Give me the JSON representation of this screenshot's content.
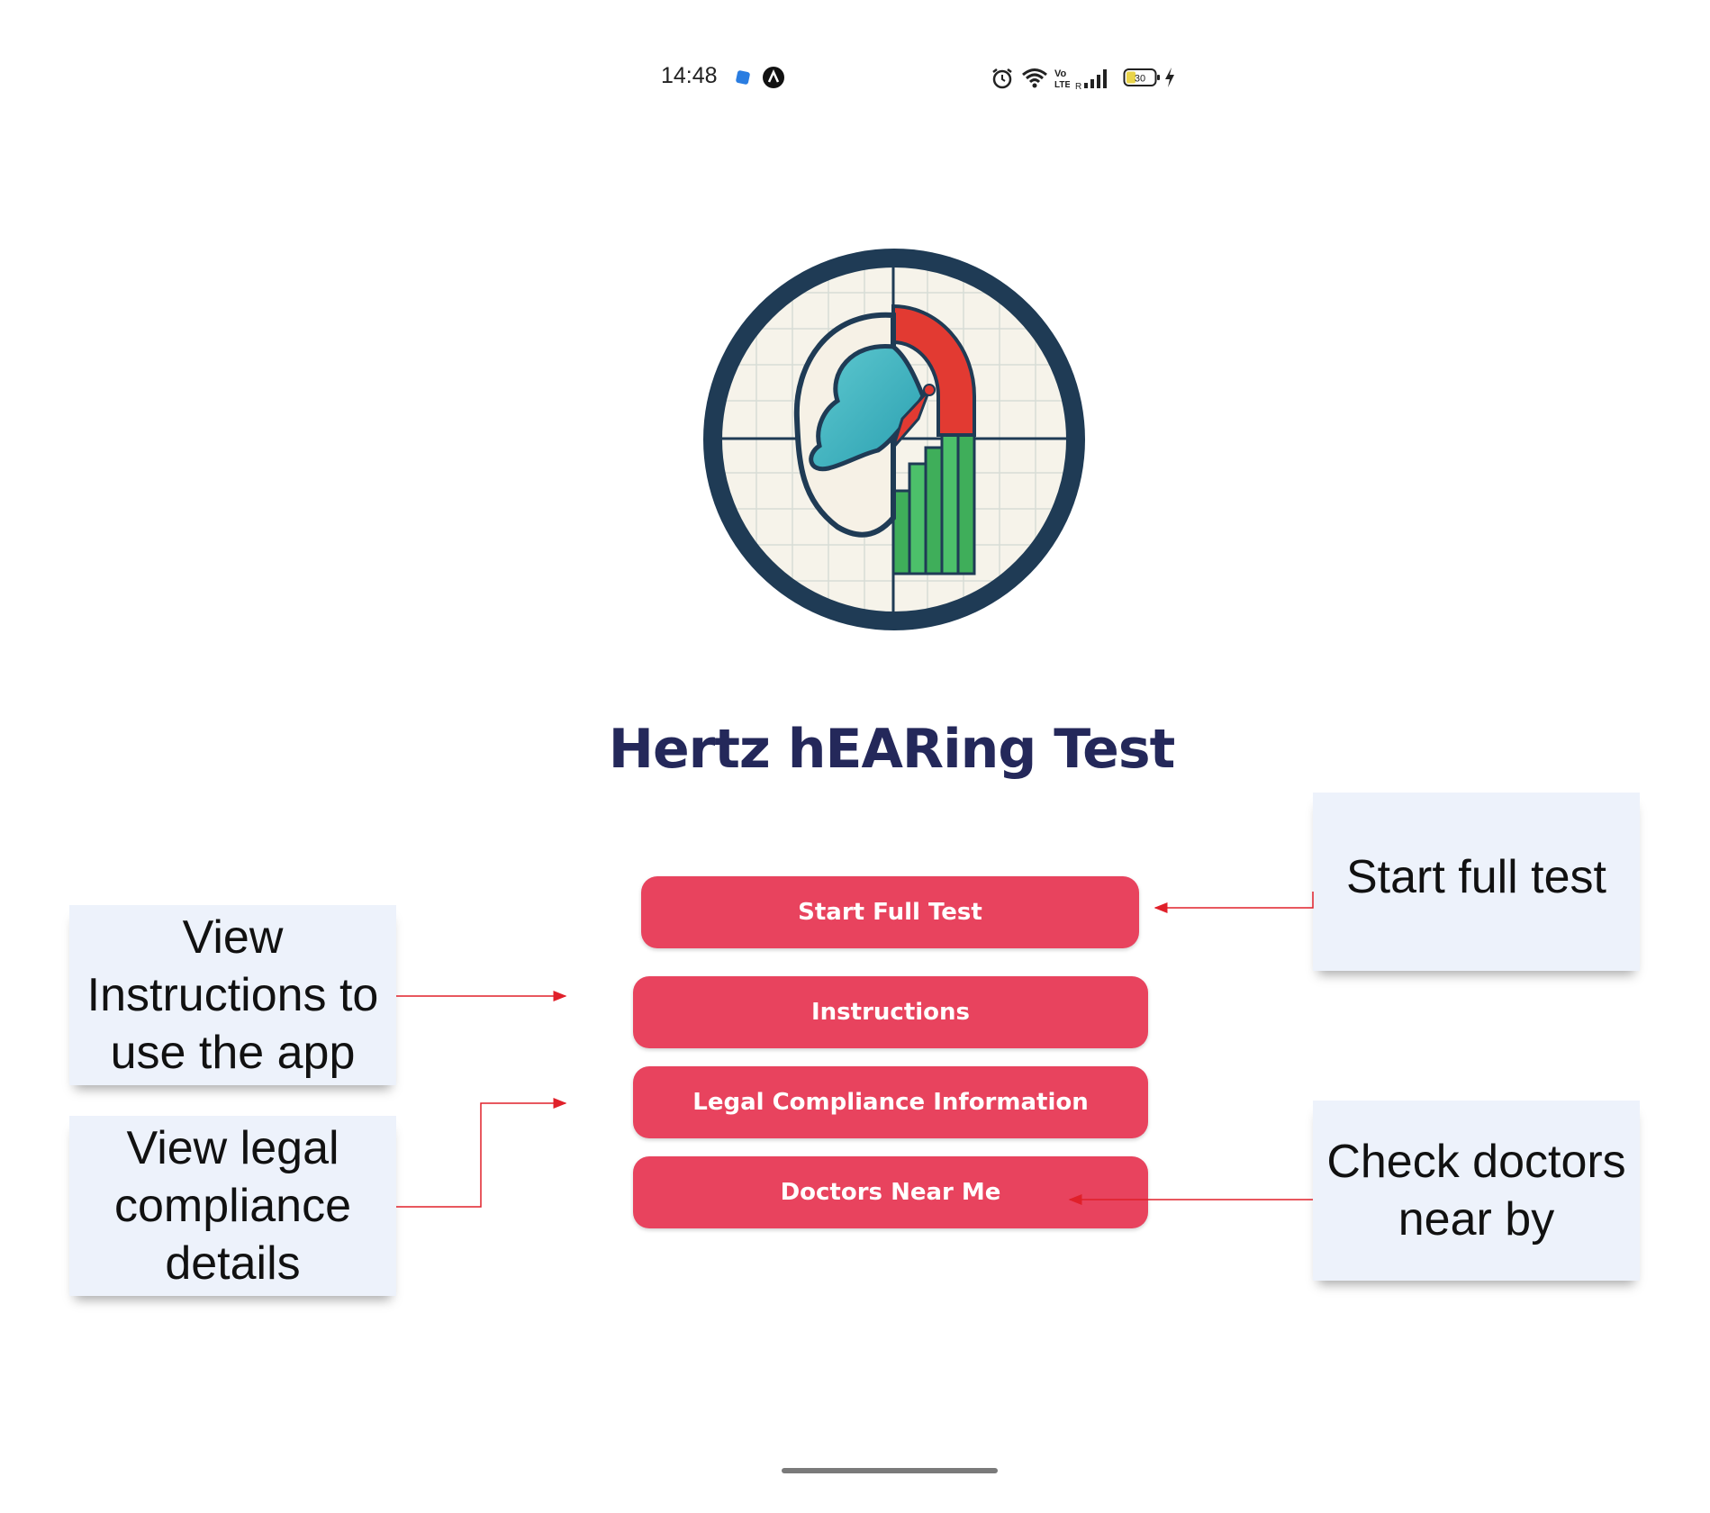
{
  "status_bar": {
    "time": "14:48",
    "battery": "30",
    "icons": [
      "app-notification-icon",
      "a-circle-icon",
      "alarm-icon",
      "wifi-icon",
      "volte-icon",
      "signal-icon",
      "battery-icon",
      "charging-icon"
    ]
  },
  "app": {
    "title": "Hertz hEARing Test",
    "logo_icon": "ear-audiogram-logo-icon"
  },
  "buttons": {
    "start_full_test": "Start Full Test",
    "instructions": "Instructions",
    "legal": "Legal Compliance Information",
    "doctors": "Doctors Near Me"
  },
  "callouts": {
    "start": "Start full test",
    "instructions": "View Instructions to use the app",
    "legal": "View legal compliance details",
    "doctors": "Check doctors near by"
  },
  "colors": {
    "button": "#e8435e",
    "title": "#24285a",
    "callout_bg": "#edf2fb",
    "arrow": "#e0202a"
  }
}
